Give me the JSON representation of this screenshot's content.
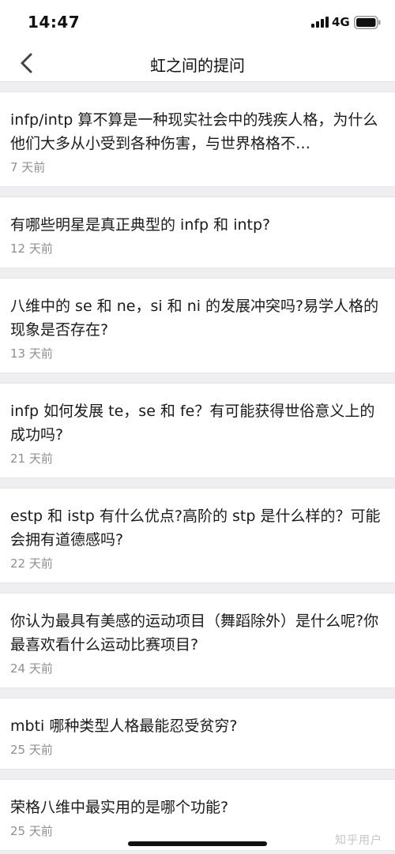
{
  "status_bar": {
    "time": "14:47",
    "network": "4G",
    "icons": [
      "signal-icon",
      "battery-icon"
    ]
  },
  "nav": {
    "title": "虹之间的提问",
    "back_icon": "chevron-left-icon"
  },
  "questions": [
    {
      "title": "infp/intp 算不算是一种现实社会中的残疾人格，为什么他们大多从小受到各种伤害，与世界格格不…",
      "time": "7 天前"
    },
    {
      "title": "有哪些明星是真正典型的 infp 和 intp?",
      "time": "12 天前"
    },
    {
      "title": "八维中的 se 和 ne，si 和 ni 的发展冲突吗?易学人格的现象是否存在?",
      "time": "13 天前"
    },
    {
      "title": "infp 如何发展 te，se 和 fe？有可能获得世俗意义上的成功吗?",
      "time": "21 天前"
    },
    {
      "title": "estp 和 istp 有什么优点?高阶的 stp 是什么样的？可能会拥有道德感吗?",
      "time": "22 天前"
    },
    {
      "title": "你认为最具有美感的运动项目（舞蹈除外）是什么呢?你最喜欢看什么运动比赛项目?",
      "time": "24 天前"
    },
    {
      "title": "mbti 哪种类型人格最能忍受贫穷?",
      "time": "25 天前"
    },
    {
      "title": "荣格八维中最实用的是哪个功能?",
      "time": "25 天前"
    }
  ],
  "watermark": "知乎用户"
}
